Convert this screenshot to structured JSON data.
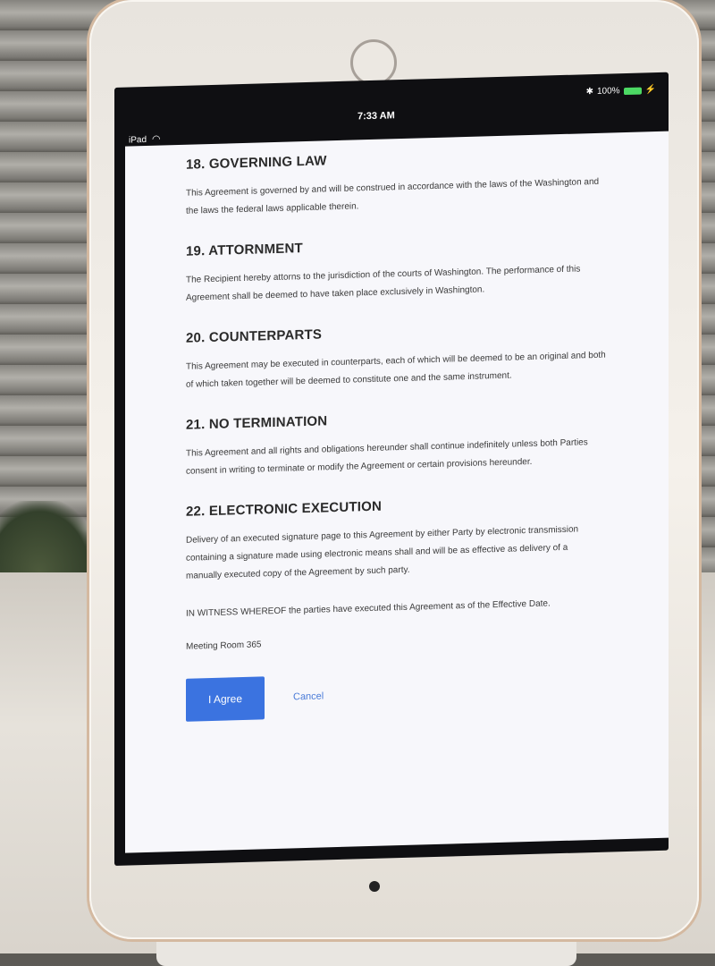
{
  "statusbar": {
    "device": "iPad",
    "time": "7:33 AM",
    "battery": "100%"
  },
  "sections": [
    {
      "title": "18. GOVERNING LAW",
      "body": "This Agreement is governed by and will be construed in accordance with the laws of the Washington and the laws the federal laws applicable therein."
    },
    {
      "title": "19. ATTORNMENT",
      "body": "The Recipient hereby attorns to the jurisdiction of the courts of Washington. The performance of this Agreement shall be deemed to have taken place exclusively in Washington."
    },
    {
      "title": "20. COUNTERPARTS",
      "body": "This Agreement may be executed in counterparts, each of which will be deemed to be an original and both of which taken together will be deemed to constitute one and the same instrument."
    },
    {
      "title": "21. NO TERMINATION",
      "body": "This Agreement and all rights and obligations hereunder shall continue indefinitely unless both Parties consent in writing to terminate or modify the Agreement or certain provisions hereunder."
    },
    {
      "title": "22. ELECTRONIC EXECUTION",
      "body": "Delivery of an executed signature page to this Agreement by either Party by electronic transmission containing a signature made using electronic means shall and will be as effective as delivery of a manually executed copy of the Agreement by such party."
    }
  ],
  "witness": "IN WITNESS WHEREOF the parties have executed this Agreement as of the Effective Date.",
  "room": "Meeting Room 365",
  "actions": {
    "agree_label": "I Agree",
    "cancel_label": "Cancel"
  },
  "colors": {
    "primary_button": "#3b73e0",
    "link": "#4a7bd8"
  }
}
